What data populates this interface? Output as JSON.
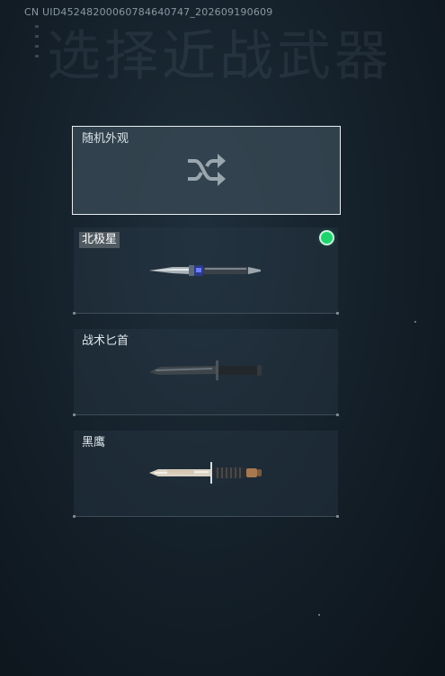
{
  "watermark": {
    "uid_text": "CN UID4524820006078464074​7_202609190609"
  },
  "header": {
    "title": "选择近战武器"
  },
  "random_option": {
    "label": "随机外观",
    "icon": "shuffle-icon"
  },
  "weapons": [
    {
      "label": "北极星",
      "equipped": true,
      "icon": "polaris-knife-icon"
    },
    {
      "label": "战术匕首",
      "equipped": false,
      "icon": "tactical-dagger-icon"
    },
    {
      "label": "黑鹰",
      "equipped": false,
      "icon": "black-hawk-knife-icon"
    }
  ],
  "colors": {
    "equipped_indicator": "#1fd46e",
    "selected_border": "#e9eef1"
  }
}
